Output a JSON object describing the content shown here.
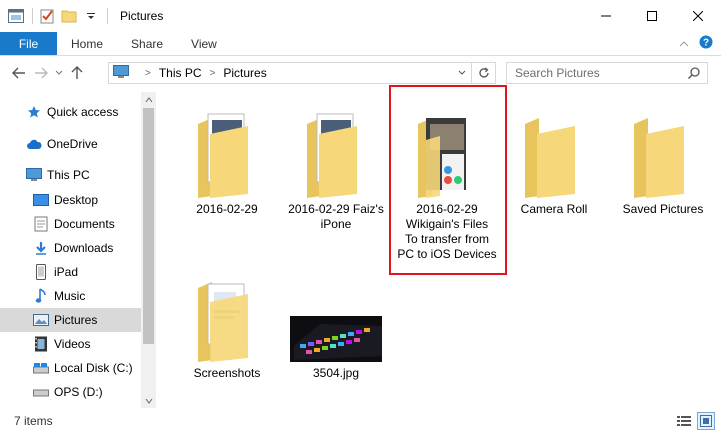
{
  "window": {
    "title": "Pictures",
    "minimize_label": "—",
    "maximize_label": "☐",
    "close_label": "✕"
  },
  "ribbon": {
    "tabs": [
      {
        "label": "File"
      },
      {
        "label": "Home"
      },
      {
        "label": "Share"
      },
      {
        "label": "View"
      }
    ]
  },
  "address": {
    "crumbs": [
      "This PC",
      "Pictures"
    ]
  },
  "search": {
    "placeholder": "Search Pictures"
  },
  "nav": {
    "items": [
      {
        "label": "Quick access",
        "icon": "star-icon"
      },
      {
        "label": "OneDrive",
        "icon": "cloud-icon"
      },
      {
        "label": "This PC",
        "icon": "computer-icon"
      },
      {
        "label": "Desktop",
        "icon": "desktop-icon"
      },
      {
        "label": "Documents",
        "icon": "documents-icon"
      },
      {
        "label": "Downloads",
        "icon": "download-icon"
      },
      {
        "label": "iPad",
        "icon": "tablet-icon"
      },
      {
        "label": "Music",
        "icon": "music-icon"
      },
      {
        "label": "Pictures",
        "icon": "pictures-icon"
      },
      {
        "label": "Videos",
        "icon": "videos-icon"
      },
      {
        "label": "Local Disk (C:)",
        "icon": "drive-icon"
      },
      {
        "label": "OPS (D:)",
        "icon": "drive-icon"
      }
    ]
  },
  "content": {
    "items": [
      {
        "label": "2016-02-29",
        "kind": "folder-with-docs"
      },
      {
        "label": "2016-02-29 Faiz's\niPone",
        "kind": "folder-with-docs"
      },
      {
        "label": "2016-02-29\nWikigain's Files\nTo transfer from\nPC to iOS Devices",
        "kind": "folder-dark-docs"
      },
      {
        "label": "Camera Roll",
        "kind": "folder-empty"
      },
      {
        "label": "Saved Pictures",
        "kind": "folder-empty"
      },
      {
        "label": "Screenshots",
        "kind": "folder-with-docs"
      },
      {
        "label": "3504.jpg",
        "kind": "image-keyboard"
      }
    ]
  },
  "status": {
    "count": "7 items"
  },
  "colors": {
    "accent": "#1979ca",
    "folder": "#f6d77a",
    "highlight": "#e0141b",
    "selected_nav": "#cce8ff"
  }
}
